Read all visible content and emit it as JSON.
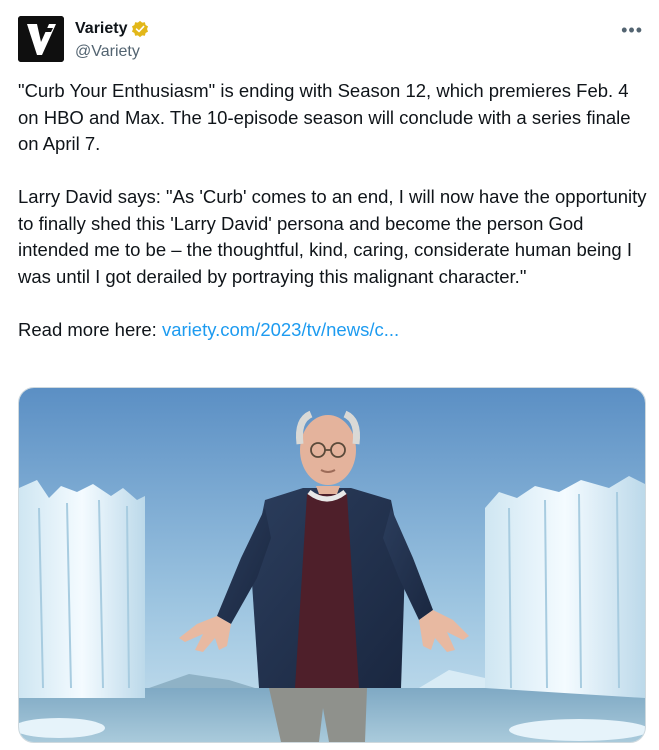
{
  "author": {
    "display_name": "Variety",
    "handle": "@Variety",
    "verified": true,
    "avatar_letter": "V",
    "verified_color": "#e2b719"
  },
  "menu": {
    "more_label": "•••"
  },
  "tweet": {
    "para1": "\"Curb Your Enthusiasm\" is ending with Season 12, which premieres Feb. 4 on HBO and Max. The 10-episode season will conclude with a series finale on April 7.",
    "para2": "Larry David says: \"As 'Curb' comes to an end, I will now have the opportunity to finally shed this 'Larry David' persona and become the person God intended me to be – the thoughtful, kind, caring, considerate human being I was until I got derailed by portraying this malignant character.\"",
    "read_more_prefix": "Read more here: ",
    "link_text": "variety.com/2023/tv/news/c..."
  },
  "colors": {
    "link": "#1d9bf0",
    "text": "#0f1419",
    "secondary": "#536471"
  }
}
